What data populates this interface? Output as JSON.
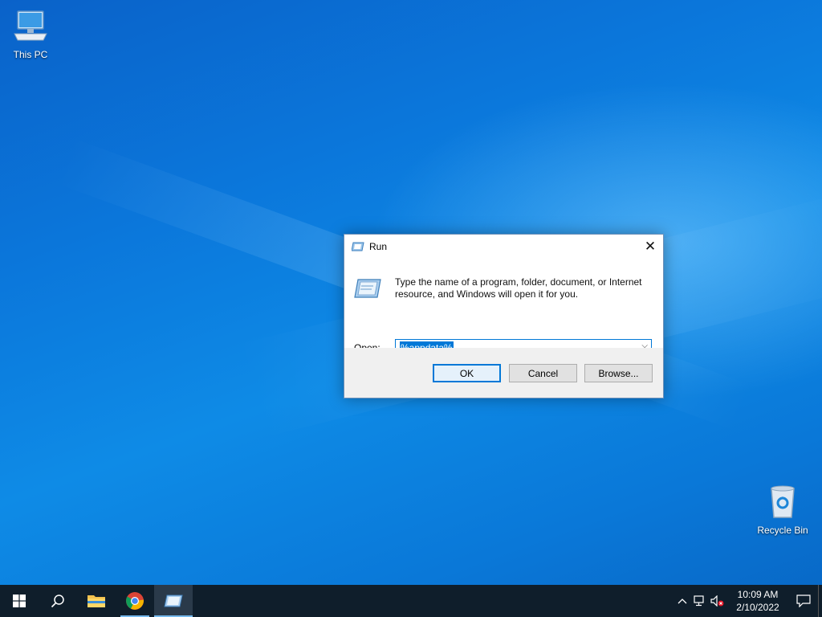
{
  "desktop": {
    "icons": [
      {
        "label": "This PC",
        "icon": "computer-icon"
      },
      {
        "label": "Recycle Bin",
        "icon": "recycle-bin-icon"
      }
    ]
  },
  "run_dialog": {
    "title": "Run",
    "description": "Type the name of a program, folder, document, or Internet resource, and Windows will open it for you.",
    "open_label": "Open:",
    "open_value": "%appdata%",
    "buttons": {
      "ok": "OK",
      "cancel": "Cancel",
      "browse": "Browse..."
    },
    "close_glyph": "✕"
  },
  "taskbar": {
    "start_icon": "windows-logo-icon",
    "search_icon": "search-icon",
    "pinned": [
      {
        "name": "file-explorer",
        "icon": "folder-icon"
      },
      {
        "name": "chrome",
        "icon": "chrome-icon"
      },
      {
        "name": "run",
        "icon": "run-icon"
      }
    ],
    "clock": {
      "time": "10:09 AM",
      "date": "2/10/2022"
    }
  },
  "colors": {
    "accent": "#0078d7",
    "taskbar_bg": "#0f1e2b",
    "desktop_bg": "#0b77db"
  }
}
